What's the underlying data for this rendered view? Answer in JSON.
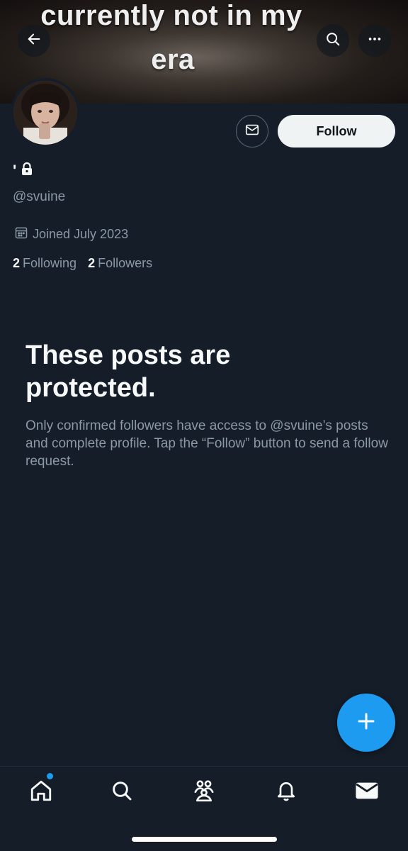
{
  "banner": {
    "line1": "currently not in my",
    "line2": "era"
  },
  "header": {
    "back_icon": "arrow-left-icon",
    "search_icon": "search-icon",
    "more_icon": "more-horizontal-icon"
  },
  "profile": {
    "display_name": "'",
    "lock_icon": "lock-icon",
    "handle": "@svuine",
    "joined": "Joined July 2023",
    "following_count": "2",
    "following_label": "Following",
    "followers_count": "2",
    "followers_label": "Followers"
  },
  "actions": {
    "message_icon": "envelope-icon",
    "follow_label": "Follow"
  },
  "protected": {
    "title": "These posts are protected.",
    "description": "Only confirmed followers have access to @svuine’s posts and complete profile. Tap the “Follow” button to send a follow request."
  },
  "fab": {
    "icon": "plus-icon"
  },
  "bottom_nav": {
    "items": [
      "home-icon",
      "search-icon",
      "communities-icon",
      "notifications-icon",
      "messages-icon"
    ]
  },
  "colors": {
    "background": "#15202b",
    "accent": "#1d9bf0",
    "secondary_text": "#8b98a5",
    "follow_button": "#eff3f4"
  }
}
